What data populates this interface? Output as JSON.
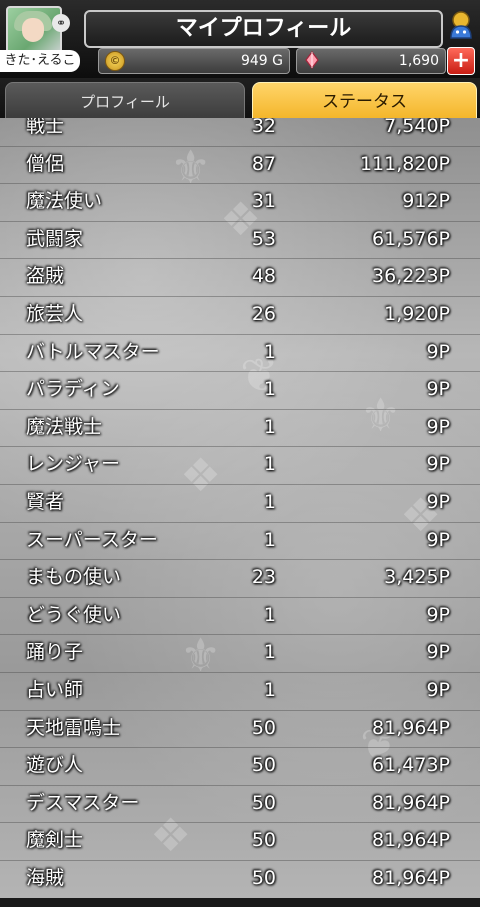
{
  "header": {
    "title": "マイプロフィール",
    "player_name": "きた･えるこ",
    "gold": "949 G",
    "gems": "1,690",
    "plus_label": "+"
  },
  "tabs": [
    {
      "label": "プロフィール",
      "active": false
    },
    {
      "label": "ステータス",
      "active": true
    }
  ],
  "jobs": [
    {
      "name": "戦士",
      "level": "32",
      "points": "7,540P"
    },
    {
      "name": "僧侶",
      "level": "87",
      "points": "111,820P"
    },
    {
      "name": "魔法使い",
      "level": "31",
      "points": "912P"
    },
    {
      "name": "武闘家",
      "level": "53",
      "points": "61,576P"
    },
    {
      "name": "盗賊",
      "level": "48",
      "points": "36,223P"
    },
    {
      "name": "旅芸人",
      "level": "26",
      "points": "1,920P"
    },
    {
      "name": "バトルマスター",
      "level": "1",
      "points": "9P"
    },
    {
      "name": "パラディン",
      "level": "1",
      "points": "9P"
    },
    {
      "name": "魔法戦士",
      "level": "1",
      "points": "9P"
    },
    {
      "name": "レンジャー",
      "level": "1",
      "points": "9P"
    },
    {
      "name": "賢者",
      "level": "1",
      "points": "9P"
    },
    {
      "name": "スーパースター",
      "level": "1",
      "points": "9P"
    },
    {
      "name": "まもの使い",
      "level": "23",
      "points": "3,425P"
    },
    {
      "name": "どうぐ使い",
      "level": "1",
      "points": "9P"
    },
    {
      "name": "踊り子",
      "level": "1",
      "points": "9P"
    },
    {
      "name": "占い師",
      "level": "1",
      "points": "9P"
    },
    {
      "name": "天地雷鳴士",
      "level": "50",
      "points": "81,964P"
    },
    {
      "name": "遊び人",
      "level": "50",
      "points": "61,473P"
    },
    {
      "name": "デスマスター",
      "level": "50",
      "points": "81,964P"
    },
    {
      "name": "魔剣士",
      "level": "50",
      "points": "81,964P"
    },
    {
      "name": "海賊",
      "level": "50",
      "points": "81,964P"
    }
  ],
  "colors": {
    "active_tab": "#f3b325",
    "plus_button": "#c81e14"
  }
}
